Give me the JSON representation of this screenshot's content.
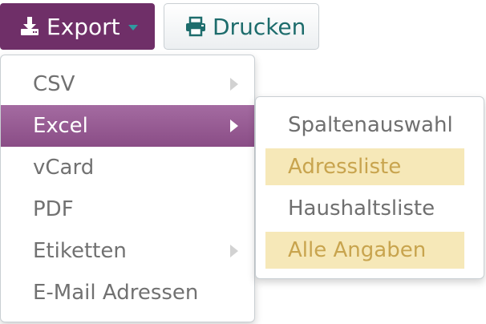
{
  "toolbar": {
    "export_label": "Export",
    "export_icon": "download-icon",
    "print_label": "Drucken",
    "print_icon": "printer-icon"
  },
  "menu": {
    "items": [
      {
        "label": "CSV",
        "has_submenu": true
      },
      {
        "label": "Excel",
        "has_submenu": true,
        "active": true
      },
      {
        "label": "vCard",
        "has_submenu": false
      },
      {
        "label": "PDF",
        "has_submenu": false
      },
      {
        "label": "Etiketten",
        "has_submenu": true
      },
      {
        "label": "E-Mail Adressen",
        "has_submenu": false
      }
    ]
  },
  "submenu": {
    "items": [
      {
        "label": "Spaltenauswahl",
        "highlighted": false
      },
      {
        "label": "Adressliste",
        "highlighted": true
      },
      {
        "label": "Haushaltsliste",
        "highlighted": false
      },
      {
        "label": "Alle Angaben",
        "highlighted": true
      }
    ]
  },
  "colors": {
    "export_bg": "#6f2f68",
    "active_item_bg": "#9a5f97",
    "highlight_bg": "#f6e8b8",
    "highlight_text": "#c8a44e",
    "print_text": "#1d6c6c",
    "caret_accent": "#2f9aa0"
  }
}
